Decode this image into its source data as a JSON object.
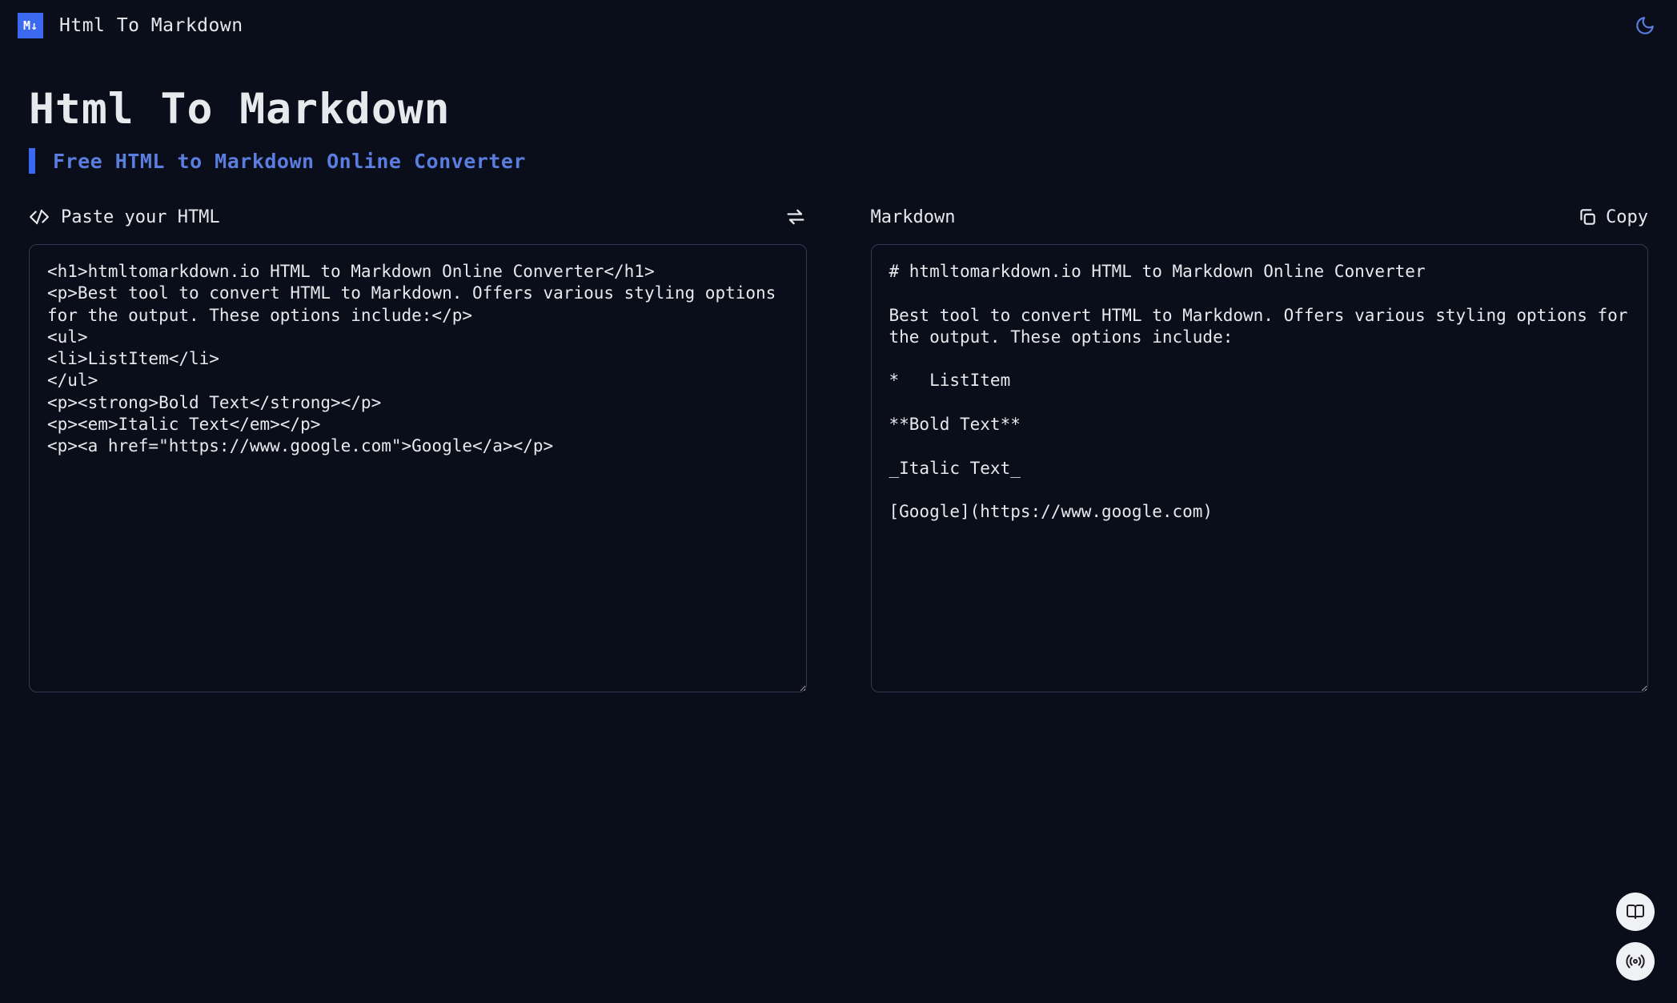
{
  "brand": {
    "logo_text": "M↓",
    "title": "Html To Markdown"
  },
  "page": {
    "title": "Html To Markdown",
    "subtitle": "Free HTML to Markdown Online Converter"
  },
  "left_panel": {
    "label": "Paste your HTML",
    "content": "<h1>htmltomarkdown.io HTML to Markdown Online Converter</h1>\n<p>Best tool to convert HTML to Markdown. Offers various styling options for the output. These options include:</p>\n<ul>\n<li>ListItem</li>\n</ul>\n<p><strong>Bold Text</strong></p>\n<p><em>Italic Text</em></p>\n<p><a href=\"https://www.google.com\">Google</a></p>"
  },
  "right_panel": {
    "label": "Markdown",
    "copy_label": "Copy",
    "content": "# htmltomarkdown.io HTML to Markdown Online Converter\n\nBest tool to convert HTML to Markdown. Offers various styling options for the output. These options include:\n\n*   ListItem\n\n**Bold Text**\n\n_Italic Text_\n\n[Google](https://www.google.com)"
  }
}
